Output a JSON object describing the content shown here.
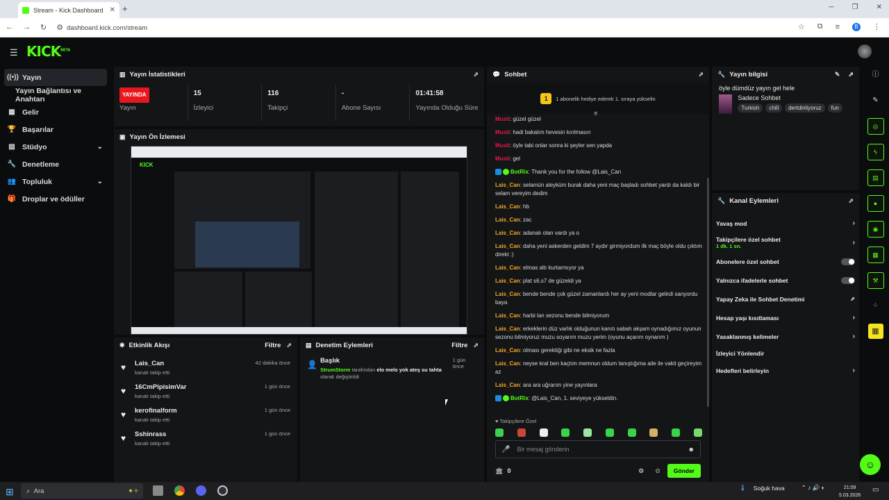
{
  "browser": {
    "tab_title": "Stream - Kick Dashboard",
    "url": "dashboard.kick.com/stream",
    "profile_initial": "B"
  },
  "header": {
    "logo": "KICK",
    "logo_badge": "BETA"
  },
  "sidebar": {
    "items": [
      {
        "label": "Yayın",
        "icon": "broadcast-icon"
      },
      {
        "label": "Yayın Bağlantısı ve Anahtarı"
      },
      {
        "label": "Gelir",
        "icon": "chart-icon"
      },
      {
        "label": "Başarılar",
        "icon": "trophy-icon"
      },
      {
        "label": "Stüdyo",
        "icon": "studio-icon"
      },
      {
        "label": "Denetleme",
        "icon": "wrench-icon"
      },
      {
        "label": "Topluluk",
        "icon": "people-icon"
      },
      {
        "label": "Droplar ve ödüller",
        "icon": "gift-icon"
      }
    ]
  },
  "stats": {
    "title": "Yayın İstatistikleri",
    "items": [
      {
        "value": "YAYINDA",
        "label": "Yayın"
      },
      {
        "value": "15",
        "label": "İzleyici"
      },
      {
        "value": "116",
        "label": "Takipçi"
      },
      {
        "value": "-",
        "label": "Abone Sayısı"
      },
      {
        "value": "01:41:58",
        "label": "Yayında Olduğu Süre"
      }
    ]
  },
  "preview": {
    "title": "Yayın Ön İzlemesi"
  },
  "activity": {
    "title": "Etkinlik Akışı",
    "filter": "Filtre",
    "items": [
      {
        "name": "Lais_Can",
        "sub": "kanalı takip etti",
        "time": "42 dakika önce"
      },
      {
        "name": "16CmPipisimVar",
        "sub": "kanalı takip etti",
        "time": "1 gün önce"
      },
      {
        "name": "kerofinalform",
        "sub": "kanalı takip etti",
        "time": "1 gün önce"
      },
      {
        "name": "Sshinrass",
        "sub": "kanalı takip etti",
        "time": "1 gün önce"
      }
    ]
  },
  "moderation": {
    "title": "Denetim Eylemleri",
    "filter": "Filtre",
    "item": {
      "title": "Başlık",
      "user": "StrumStorm",
      "mid": "tarafından",
      "bold": "elo melo yok ateş su tahta",
      "end": "olarak değiştirildi",
      "time": "1 gün önce"
    }
  },
  "chat": {
    "title": "Sohbet",
    "gift_count": "1",
    "gift_text": "1 abonelik hediye ederek 1. sıraya yükselin",
    "messages": [
      {
        "user": "Musti",
        "color": "red",
        "text": "güzel güzel"
      },
      {
        "user": "Musti",
        "color": "red",
        "text": "hadi bakalım hevesin kırılmasın"
      },
      {
        "user": "Musti",
        "color": "red",
        "text": "öyle tabi onlar sonra ki şeyler sen yapda"
      },
      {
        "user": "Musti",
        "color": "red",
        "text": "gel"
      },
      {
        "user": "BotRix",
        "color": "green",
        "bot": true,
        "text": "Thank you for the follow @Lais_Can"
      },
      {
        "user": "Lais_Can",
        "color": "yellow",
        "text": "selamün aleyküm burak daha yeni maç başladı sohbet yardı da kaldı bir selam vereyim dedim"
      },
      {
        "user": "Lais_Can",
        "color": "yellow",
        "text": "hb"
      },
      {
        "user": "Lais_Can",
        "color": "yellow",
        "text": "zac"
      },
      {
        "user": "Lais_Can",
        "color": "yellow",
        "text": "adanalı olan vardı ya o"
      },
      {
        "user": "Lais_Can",
        "color": "yellow",
        "text": "daha yeni askerden geldim 7 aydır girmiyordum ilk maç böyle oldu çıktım direkt :)"
      },
      {
        "user": "Lais_Can",
        "color": "yellow",
        "text": "elmas altı kurtarmıyor ya"
      },
      {
        "user": "Lais_Can",
        "color": "yellow",
        "text": "plat s6,s7 de güzeldi ya"
      },
      {
        "user": "Lais_Can",
        "color": "yellow",
        "text": "bende bende çok güzel zamanlardı her ay yeni modlar gelirdi sanyordu baya"
      },
      {
        "user": "Lais_Can",
        "color": "yellow",
        "text": "harbi lan sezonu bende bilmiyorum"
      },
      {
        "user": "Lais_Can",
        "color": "yellow",
        "text": "erkeklerin düz varlık olduğunun kanıtı sabah akşam oynadığımız oyunun sezonu bilmiyoruz muzu soyarım muzu yerim (oyunu açarım oynarım )"
      },
      {
        "user": "Lais_Can",
        "color": "yellow",
        "text": "olması gerektiği gibi ne eksik ne fazla"
      },
      {
        "user": "Lais_Can",
        "color": "yellow",
        "text": "neyse kral ben kaçtım memnun oldum tanıştığıma aile ile vakit geçireyim az"
      },
      {
        "user": "Lais_Can",
        "color": "yellow",
        "text": "ara ara uğrarım yine yayınlara"
      },
      {
        "user": "BotRix",
        "color": "green",
        "bot": true,
        "text": "@Lais_Can, 1. seviyeye yükseldin."
      }
    ],
    "emotes_label": "Takipçilere Özel",
    "input_placeholder": "Bir mesaj gönderin",
    "points": "0",
    "send": "Gönder"
  },
  "stream_info": {
    "title": "Yayın bilgisi",
    "stream_title": "öyle dümdüz yayın gel hele",
    "category": "Sadece Sohbet",
    "tags": [
      "Turkish",
      "chill",
      "dertdinliyoruz",
      "fun"
    ]
  },
  "channel_actions": {
    "title": "Kanal Eylemleri",
    "items": [
      {
        "label": "Yavaş mod",
        "type": "chevron"
      },
      {
        "label": "Takipçilere özel sohbet",
        "sub": "1 dk. 1 sn.",
        "type": "chevron"
      },
      {
        "label": "Abonelere özel sohbet",
        "type": "toggle"
      },
      {
        "label": "Yalnızca ifadelerle sohbet",
        "type": "toggle"
      },
      {
        "label": "Yapay Zeka ile Sohbet Denetimi",
        "type": "external"
      },
      {
        "label": "Hesap yaşı kısıtlaması",
        "type": "chevron"
      },
      {
        "label": "Yasaklanmış kelimeler",
        "type": "chevron"
      },
      {
        "label": "İzleyici Yönlendir",
        "type": "none"
      },
      {
        "label": "Hedefleri belirleyin",
        "type": "chevron"
      }
    ]
  },
  "taskbar": {
    "search": "Ara",
    "weather": "Soğuk hava",
    "time": "21:09",
    "date": "5.03.2026"
  }
}
